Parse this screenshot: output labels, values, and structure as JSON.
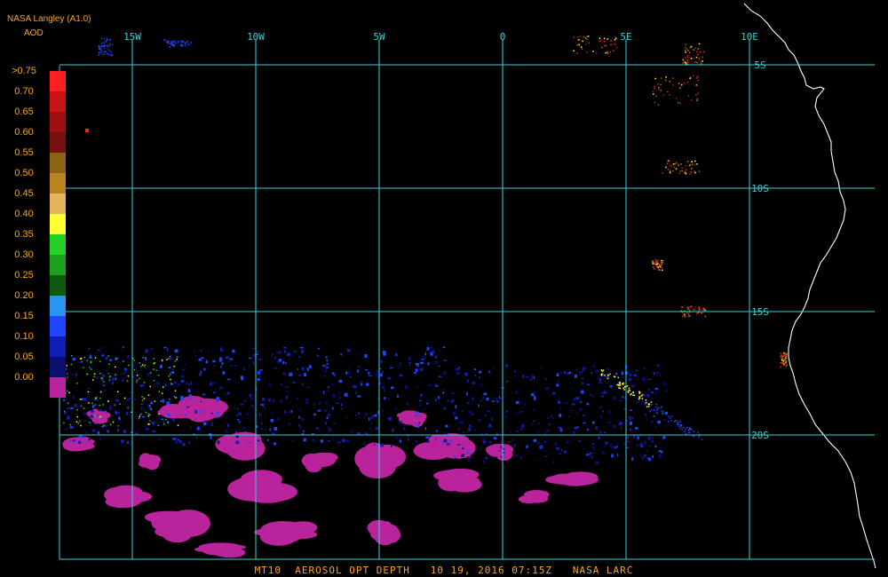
{
  "header": {
    "product": "NASA Langley (A1.0)",
    "parameter": "AOD"
  },
  "footer": {
    "caption": "MT10  AEROSOL OPT DEPTH   10 19, 2016 07:15Z   NASA LARC"
  },
  "legend": {
    "items": [
      {
        "label": ">0.75",
        "color": "#ff1f1f"
      },
      {
        "label": "0.70",
        "color": "#c81414"
      },
      {
        "label": "0.65",
        "color": "#a00f0f"
      },
      {
        "label": "0.60",
        "color": "#781212"
      },
      {
        "label": "0.55",
        "color": "#8c6414"
      },
      {
        "label": "0.50",
        "color": "#b9851e"
      },
      {
        "label": "0.45",
        "color": "#e6b45a"
      },
      {
        "label": "0.40",
        "color": "#ffff32"
      },
      {
        "label": "0.35",
        "color": "#23d223"
      },
      {
        "label": "0.30",
        "color": "#1ea01e"
      },
      {
        "label": "0.25",
        "color": "#0f5a0f"
      },
      {
        "label": "0.20",
        "color": "#2896f0"
      },
      {
        "label": "0.15",
        "color": "#1e46ff"
      },
      {
        "label": "0.10",
        "color": "#0f1eb9"
      },
      {
        "label": "0.05",
        "color": "#0a0f6e"
      },
      {
        "label": "0.00",
        "color": "#b9239b"
      }
    ]
  },
  "grid": {
    "line_color": "#3ecfd8",
    "label_color": "#3ecfd8",
    "longitudes": [
      {
        "label": "15W",
        "value": -15
      },
      {
        "label": "10W",
        "value": -10
      },
      {
        "label": "5W",
        "value": -5
      },
      {
        "label": "0",
        "value": 0
      },
      {
        "label": "5E",
        "value": 5
      },
      {
        "label": "10E",
        "value": 10
      }
    ],
    "latitudes": [
      {
        "label": "5S",
        "value": -5
      },
      {
        "label": "10S",
        "value": -10
      },
      {
        "label": "15S",
        "value": -15
      },
      {
        "label": "20S",
        "value": -20
      }
    ]
  },
  "colors": {
    "background": "#000000",
    "coastline": "#ffffff",
    "text": "#f5a623"
  }
}
